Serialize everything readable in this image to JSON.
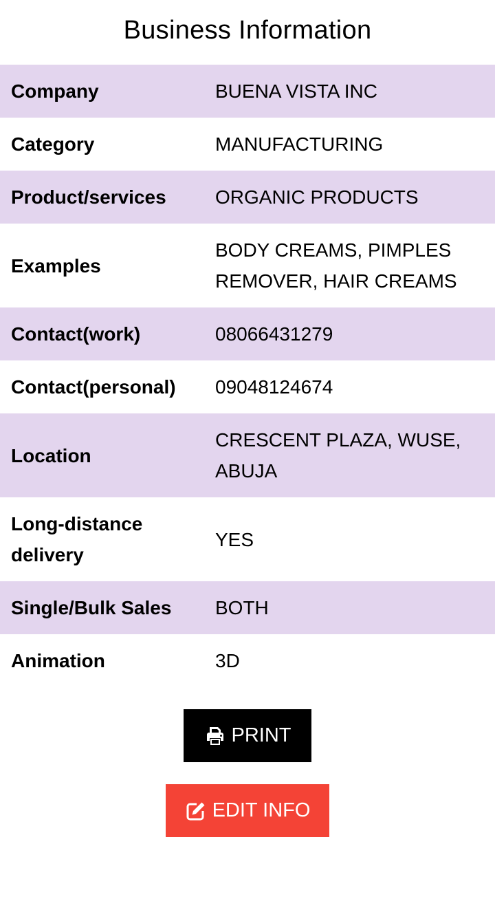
{
  "page": {
    "title": "Business Information"
  },
  "info": {
    "rows": [
      {
        "label": "Company",
        "value": "BUENA VISTA INC"
      },
      {
        "label": "Category",
        "value": "MANUFACTURING"
      },
      {
        "label": "Product/services",
        "value": "ORGANIC PRODUCTS"
      },
      {
        "label": "Examples",
        "value": "BODY CREAMS, PIMPLES REMOVER, HAIR CREAMS"
      },
      {
        "label": "Contact(work)",
        "value": "08066431279"
      },
      {
        "label": "Contact(personal)",
        "value": "09048124674"
      },
      {
        "label": "Location",
        "value": "CRESCENT PLAZA, WUSE, ABUJA"
      },
      {
        "label": "Long-distance delivery",
        "value": "YES"
      },
      {
        "label": "Single/Bulk Sales",
        "value": "BOTH"
      },
      {
        "label": "Animation",
        "value": "3D"
      }
    ]
  },
  "actions": {
    "print_label": "PRINT",
    "print_icon": "print-icon",
    "edit_label": "EDIT INFO",
    "edit_icon": "edit-icon"
  },
  "colors": {
    "row_shade": "#e3d5ee",
    "print_button": "#000000",
    "edit_button": "#f44336"
  }
}
